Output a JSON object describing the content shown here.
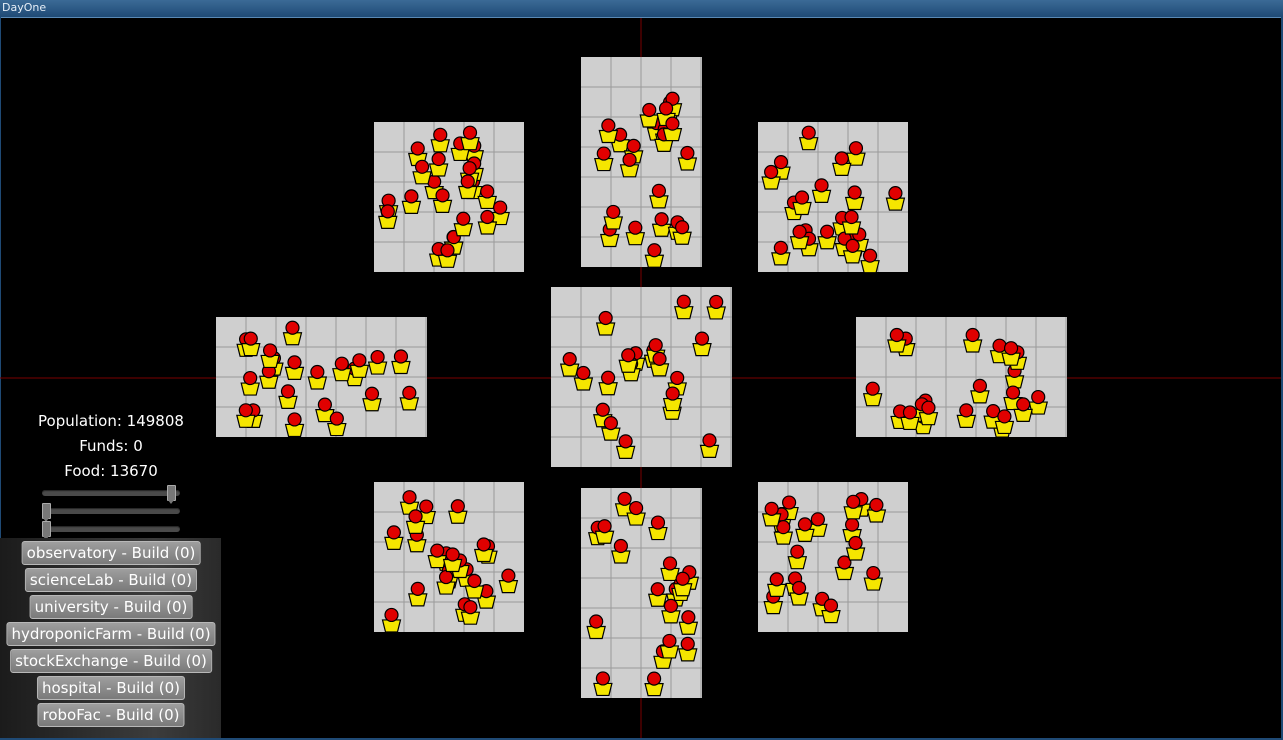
{
  "window": {
    "title": "DayOne"
  },
  "stats": {
    "population": "Population: 149808",
    "funds": "Funds: 0",
    "food": "Food: 13670"
  },
  "sliders": [
    {
      "name": "slider-1",
      "value": 0.96
    },
    {
      "name": "slider-2",
      "value": 0.0
    },
    {
      "name": "slider-3",
      "value": 0.0
    }
  ],
  "build_buttons": [
    "observatory - Build (0)",
    "scienceLab - Build (0)",
    "university - Build (0)",
    "hydroponicFarm - Build (0)",
    "stockExchange - Build (0)",
    "hospital - Build (0)",
    "roboFac - Build (0)"
  ],
  "colors": {
    "background": "#000000",
    "tile": "#cfcfcf",
    "grid": "#9a9a9a",
    "crosshair": "#7a0000",
    "head": "#e00000",
    "body": "#f5e600"
  },
  "zones": [
    {
      "name": "zone-north",
      "population_markers": 22
    },
    {
      "name": "zone-north-west",
      "population_markers": 24
    },
    {
      "name": "zone-north-east",
      "population_markers": 22
    },
    {
      "name": "zone-west",
      "population_markers": 22
    },
    {
      "name": "zone-center",
      "population_markers": 20
    },
    {
      "name": "zone-east",
      "population_markers": 22
    },
    {
      "name": "zone-south-west",
      "population_markers": 22
    },
    {
      "name": "zone-south",
      "population_markers": 20
    },
    {
      "name": "zone-south-east",
      "population_markers": 20
    }
  ]
}
